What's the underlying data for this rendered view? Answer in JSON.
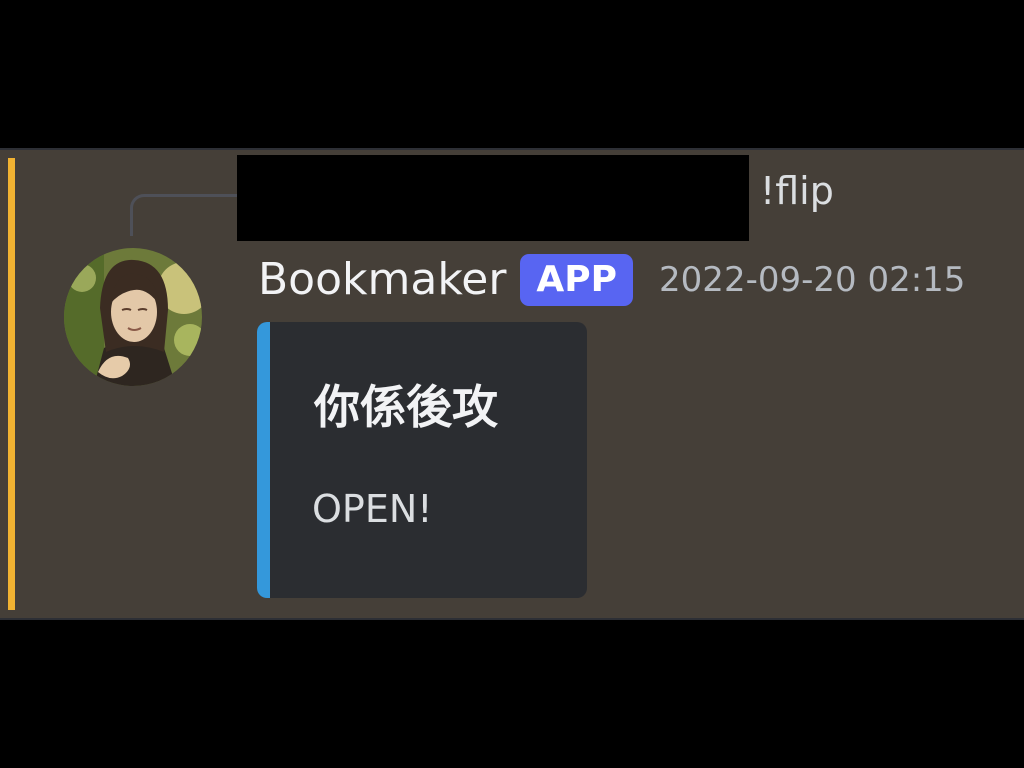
{
  "reply": {
    "content": "!flip"
  },
  "message": {
    "author": "Bookmaker",
    "badge": "APP",
    "timestamp": "2022-09-20 02:15",
    "embed": {
      "title": "你係後攻",
      "description": "OPEN!"
    }
  },
  "colors": {
    "panel_background": "#453f38",
    "mention_bar": "#f0b232",
    "app_badge": "#5865f2",
    "embed_background": "#2b2d31",
    "embed_accent": "#3498db"
  }
}
